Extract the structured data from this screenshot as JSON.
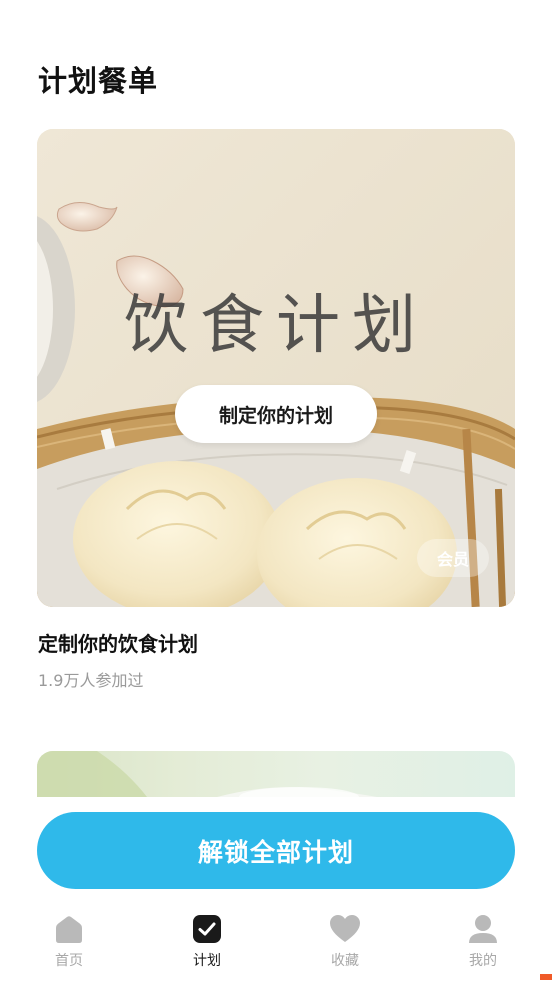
{
  "header": {
    "title": "计划餐单"
  },
  "plan_card": {
    "hero_text": "饮食计划",
    "cta_label": "制定你的计划",
    "badge_label": "会员",
    "title": "定制你的饮食计划",
    "participants": "1.9万人参加过"
  },
  "unlock_button": {
    "label": "解锁全部计划"
  },
  "tabbar": {
    "items": [
      {
        "label": "首页",
        "icon": "home-icon",
        "active": false
      },
      {
        "label": "计划",
        "icon": "checkbox-icon",
        "active": true
      },
      {
        "label": "收藏",
        "icon": "heart-icon",
        "active": false
      },
      {
        "label": "我的",
        "icon": "user-icon",
        "active": false
      }
    ]
  },
  "colors": {
    "accent": "#2fb9ea",
    "tab_inactive": "#a8a8a8",
    "tab_active": "#1a1a1a",
    "subtext": "#9a9a9a"
  }
}
